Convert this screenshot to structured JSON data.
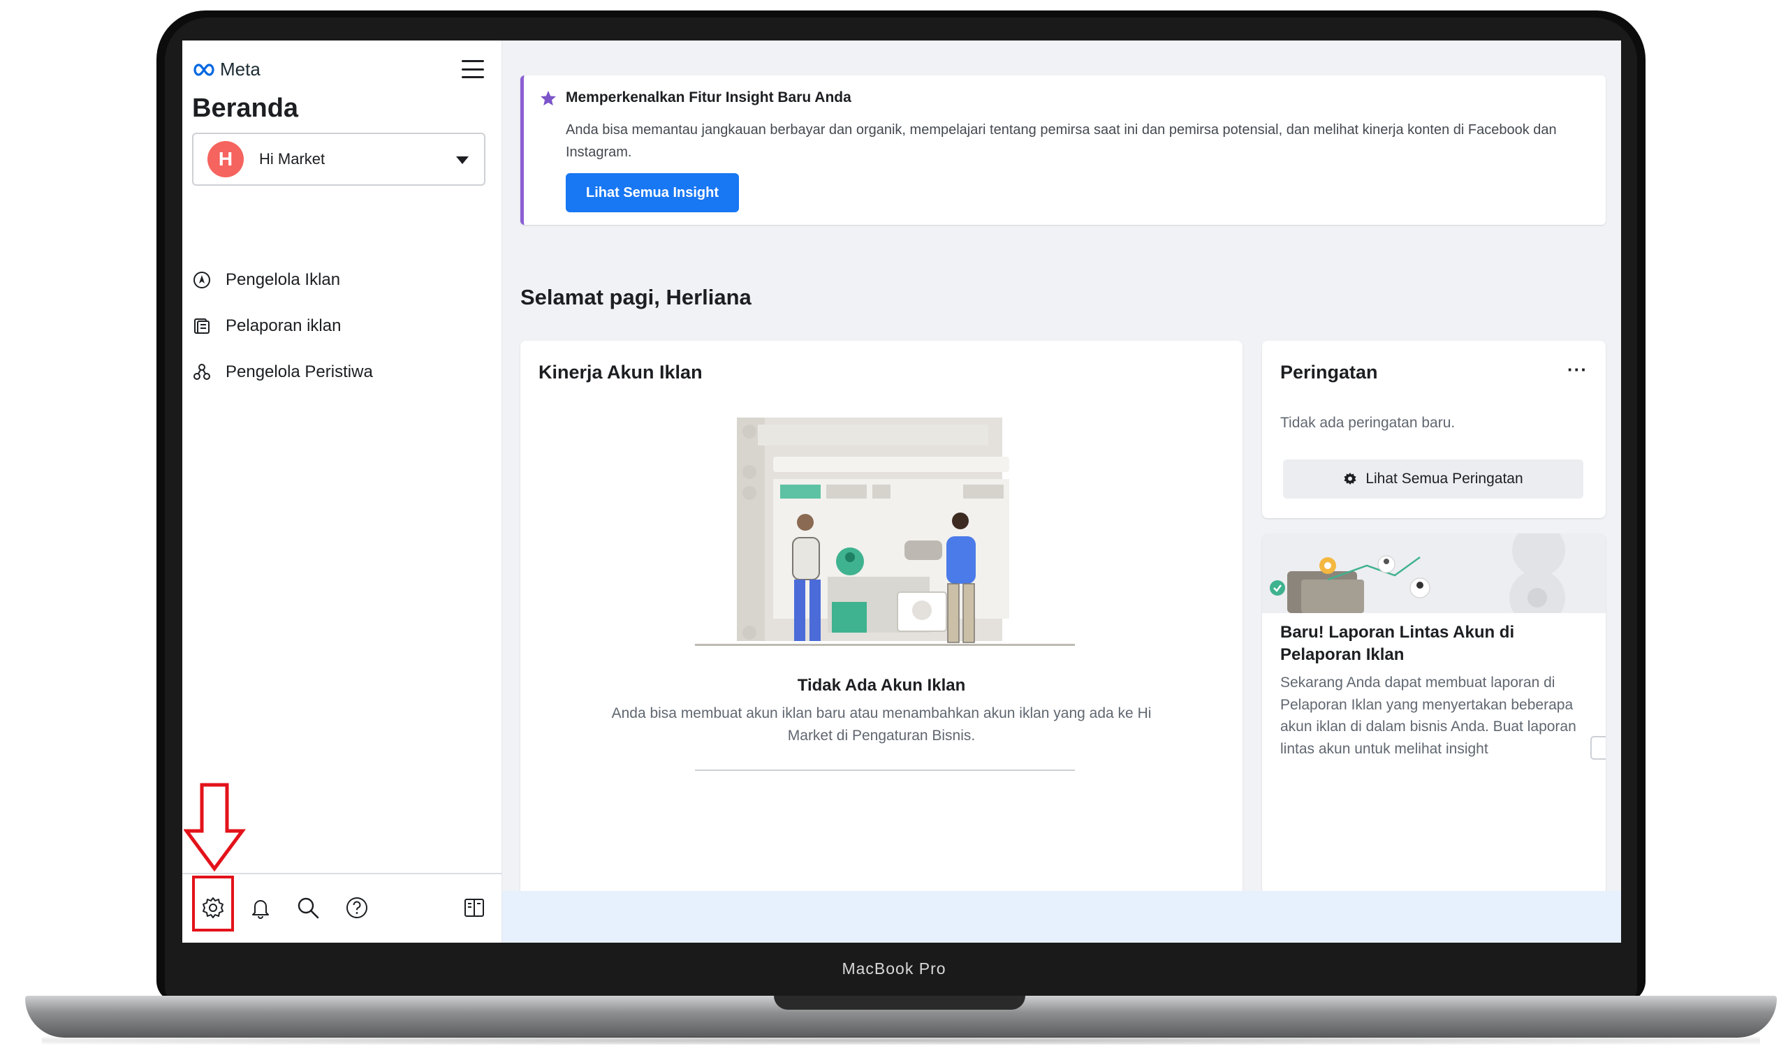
{
  "device": {
    "label": "MacBook Pro"
  },
  "sidebar": {
    "logo_text": "Meta",
    "title": "Beranda",
    "account": {
      "avatar_letter": "H",
      "name": "Hi Market"
    },
    "nav": [
      {
        "label": "Pengelola Iklan",
        "icon": "compass-icon"
      },
      {
        "label": "Pelaporan iklan",
        "icon": "report-icon"
      },
      {
        "label": "Pengelola Peristiwa",
        "icon": "events-icon"
      }
    ],
    "bottom_icons": [
      "settings-icon",
      "bell-icon",
      "search-icon",
      "help-icon",
      "panel-toggle-icon"
    ]
  },
  "banner": {
    "title": "Memperkenalkan Fitur Insight Baru Anda",
    "text": "Anda bisa memantau jangkauan berbayar dan organik, mempelajari tentang pemirsa saat ini dan pemirsa potensial, dan melihat kinerja konten di Facebook dan Instagram.",
    "button": "Lihat Semua Insight"
  },
  "greeting": "Selamat pagi, Herliana",
  "performance_card": {
    "title": "Kinerja Akun Iklan",
    "empty_title": "Tidak Ada Akun Iklan",
    "empty_text": "Anda bisa membuat akun iklan baru atau menambahkan akun iklan yang ada ke Hi Market di Pengaturan Bisnis."
  },
  "warnings_card": {
    "title": "Peringatan",
    "more": "···",
    "text": "Tidak ada peringatan baru.",
    "button": "Lihat Semua Peringatan"
  },
  "promo_card": {
    "title": "Baru! Laporan Lintas Akun di Pelaporan Iklan",
    "text": "Sekarang Anda dapat membuat laporan di Pelaporan Iklan yang menyertakan beberapa akun iklan di dalam bisnis Anda. Buat laporan lintas akun untuk melihat insight"
  },
  "colors": {
    "primary": "#1877f2",
    "banner_accent": "#8b5fd3",
    "annotation": "#e3121a"
  }
}
